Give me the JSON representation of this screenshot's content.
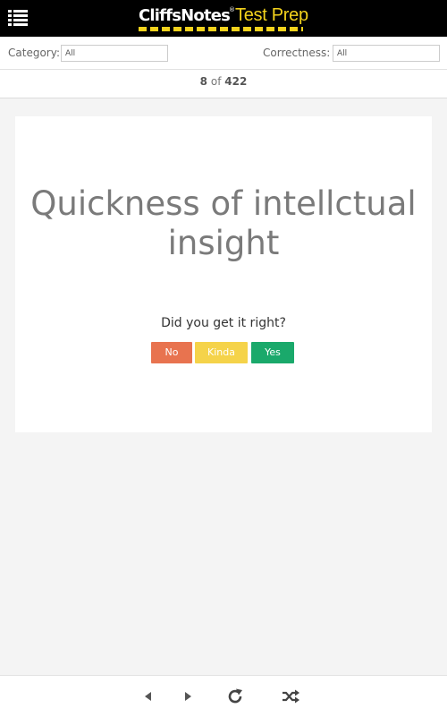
{
  "header": {
    "brand": "CliffsNotes",
    "registered": "®",
    "product": "Test Prep"
  },
  "filters": {
    "category_label": "Category:",
    "category_value": "All",
    "correctness_label": "Correctness:",
    "correctness_value": "All"
  },
  "counter": {
    "current": "8",
    "of": "of",
    "total": "422"
  },
  "card": {
    "question_line1": "Quickness of intellctual",
    "question_line2": "insight",
    "prompt": "Did you get it right?",
    "buttons": {
      "no": "No",
      "kinda": "Kinda",
      "yes": "Yes"
    }
  },
  "colors": {
    "no": "#e8734f",
    "kinda": "#f5d34a",
    "yes": "#1aa96b",
    "brand_yellow": "#f3d21c"
  },
  "footer": {
    "icons": [
      "prev-icon",
      "next-icon",
      "refresh-icon",
      "shuffle-icon"
    ]
  }
}
